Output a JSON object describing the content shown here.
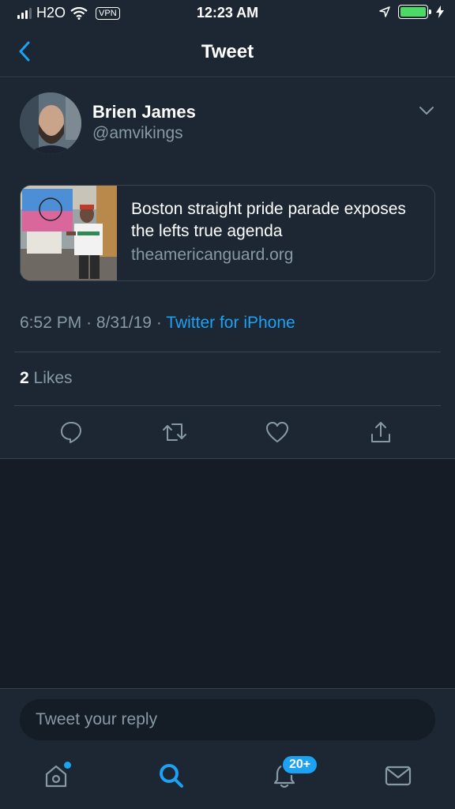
{
  "status_bar": {
    "carrier": "H2O",
    "vpn": "VPN",
    "time": "12:23 AM"
  },
  "nav": {
    "title": "Tweet",
    "back_icon": "chevron-left-icon"
  },
  "tweet": {
    "author_name": "Brien James",
    "author_handle": "@amvikings",
    "card": {
      "title": "Boston straight pride parade exposes the lefts true agenda",
      "domain": "theamericanguard.org",
      "thumb_sign_text": "STRAIGHT PRIDE"
    },
    "time": "6:52 PM",
    "date": "8/31/19",
    "separator": "·",
    "source": "Twitter for iPhone",
    "likes_count": "2",
    "likes_label": "Likes"
  },
  "actions": [
    "reply-icon",
    "retweet-icon",
    "like-icon",
    "share-icon"
  ],
  "reply": {
    "placeholder": "Tweet your reply"
  },
  "tabbar": {
    "notifications_badge": "20+",
    "tabs": [
      "home-icon",
      "search-icon",
      "notifications-icon",
      "messages-icon"
    ]
  },
  "colors": {
    "background": "#151c26",
    "panel": "#1c2733",
    "accent": "#1da1f2",
    "muted": "#8899a6",
    "border": "#38444d"
  }
}
